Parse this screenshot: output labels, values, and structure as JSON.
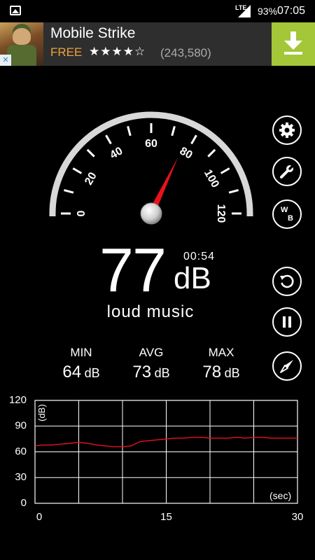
{
  "status": {
    "signal_type": "LTE",
    "battery": "93%",
    "time": "07:05"
  },
  "ad": {
    "title": "Mobile Strike",
    "price": "FREE",
    "stars": "★★★★☆",
    "rating_count": "(243,580)",
    "icons": {
      "ad_choices": "close-ad-icon",
      "download": "download-icon"
    }
  },
  "gauge": {
    "min": 0,
    "max": 120,
    "ticks": [
      "0",
      "20",
      "40",
      "60",
      "80",
      "100",
      "120"
    ],
    "needle_value": 77
  },
  "reading": {
    "value": "77",
    "unit": "dB",
    "elapsed": "00:54",
    "description": "loud music"
  },
  "stats": [
    {
      "label": "MIN",
      "value": "64",
      "unit": "dB"
    },
    {
      "label": "AVG",
      "value": "73",
      "unit": "dB"
    },
    {
      "label": "MAX",
      "value": "78",
      "unit": "dB"
    }
  ],
  "buttons": [
    {
      "name": "settings-button",
      "icon": "gear-icon"
    },
    {
      "name": "tools-button",
      "icon": "wrench-icon"
    },
    {
      "name": "weighting-button",
      "icon": "wb-icon",
      "label_w": "W",
      "label_b": "B"
    },
    {
      "name": "reset-button",
      "icon": "refresh-icon"
    },
    {
      "name": "pause-button",
      "icon": "pause-icon"
    },
    {
      "name": "calibrate-button",
      "icon": "compass-icon"
    }
  ],
  "chart_data": {
    "type": "line",
    "ylabel": "(dB)",
    "xlabel": "(sec)",
    "xlim": [
      0,
      30
    ],
    "ylim": [
      0,
      120
    ],
    "x_ticks": [
      "0",
      "15",
      "30"
    ],
    "y_ticks": [
      "0",
      "30",
      "60",
      "90",
      "120"
    ],
    "grid": true,
    "series": [
      {
        "color": "#e8131b",
        "x": [
          0,
          1,
          2,
          3,
          4,
          5,
          6,
          7,
          8,
          9,
          10,
          11,
          12,
          13,
          14,
          15,
          16,
          17,
          18,
          19,
          20,
          21,
          22,
          23,
          24,
          25,
          26,
          27,
          28,
          29,
          30
        ],
        "y": [
          67,
          68,
          68,
          69,
          70,
          71,
          70,
          68,
          67,
          66,
          66,
          67,
          72,
          73,
          74,
          75,
          76,
          76,
          77,
          77,
          76,
          76,
          76,
          77,
          76,
          77,
          77,
          76,
          76,
          76,
          76
        ]
      }
    ]
  }
}
